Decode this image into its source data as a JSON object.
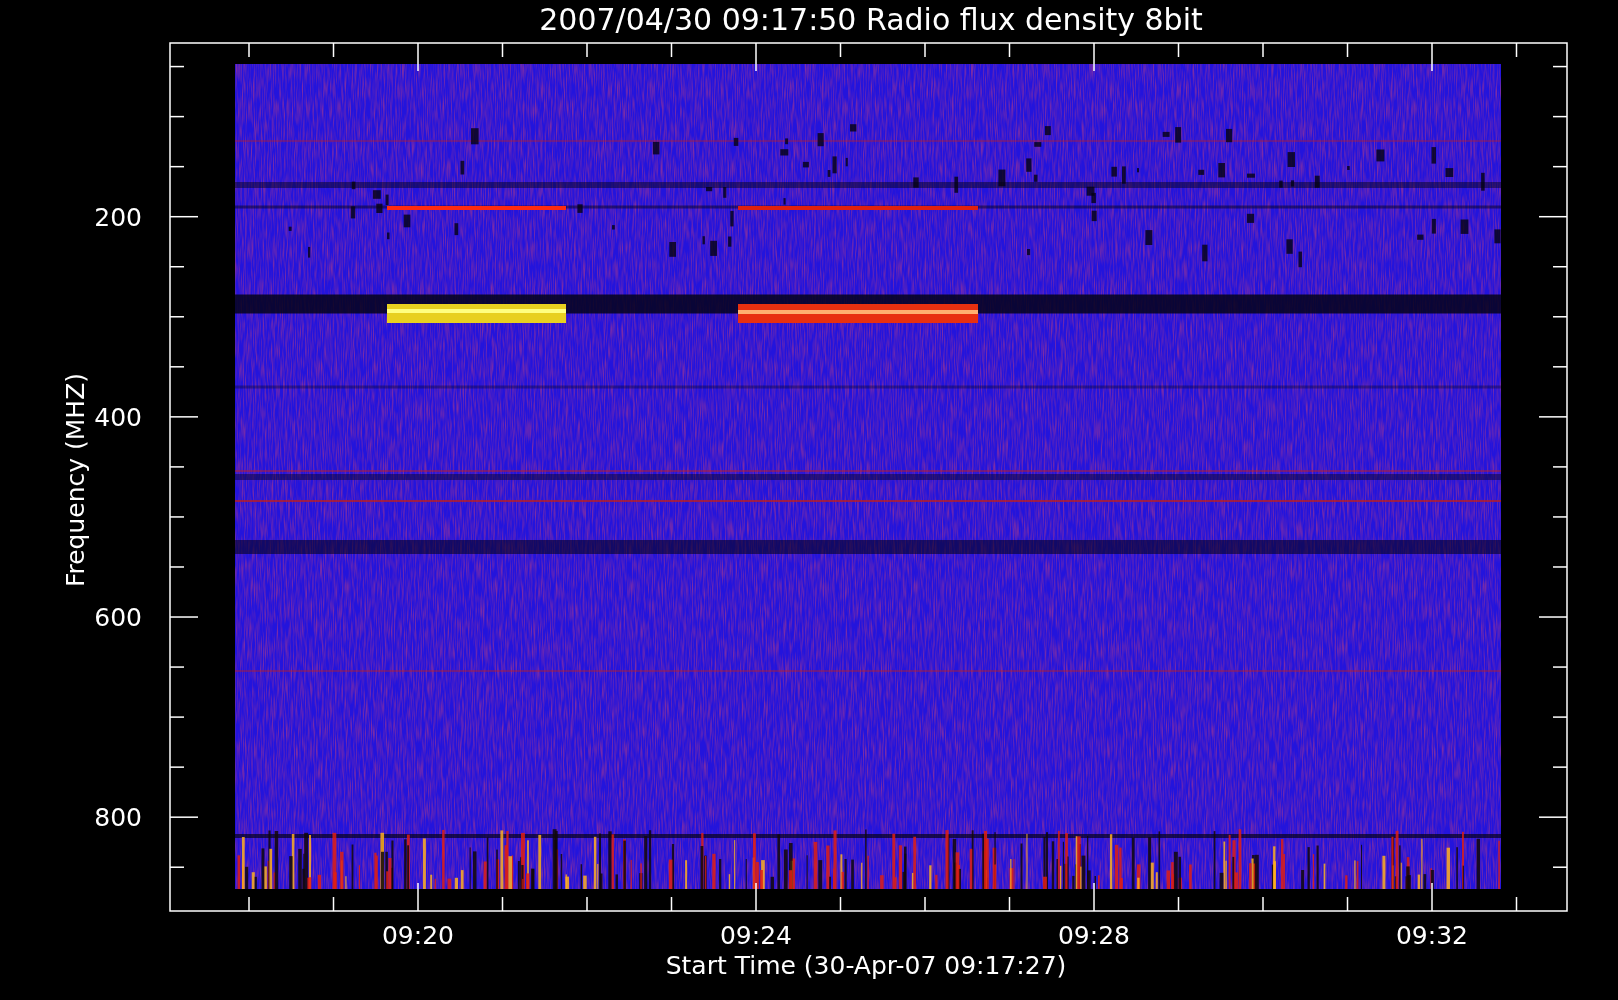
{
  "title": "2007/04/30 09:17:50 Radio flux density 8bit",
  "xlabel": "Start Time (30-Apr-07 09:17:27)",
  "ylabel": "Frequency (MHZ)",
  "xticks": [
    "09:20",
    "09:24",
    "09:28",
    "09:32"
  ],
  "yticks": [
    "200",
    "400",
    "600",
    "800"
  ]
}
